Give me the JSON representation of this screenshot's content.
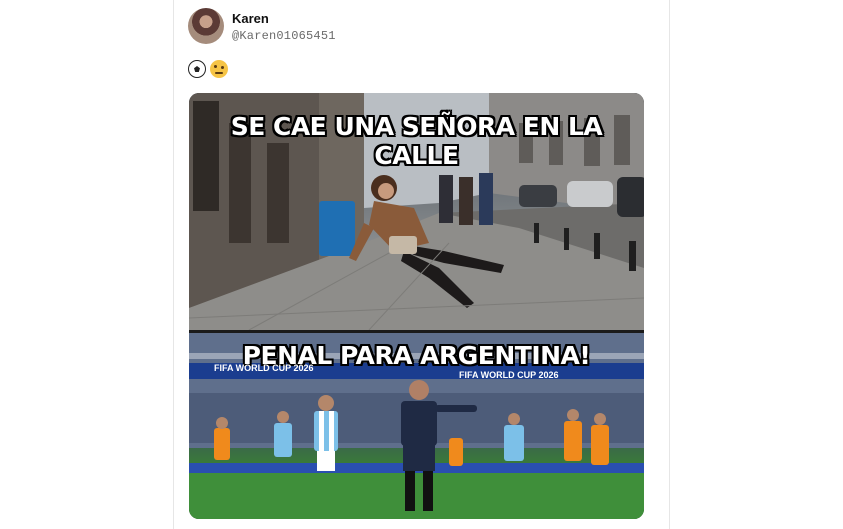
{
  "post": {
    "author_name": "Karen",
    "author_handle": "@Karen01065451",
    "body_emojis": [
      "soccer-ball-icon",
      "face-with-raised-eyebrow-icon"
    ]
  },
  "meme": {
    "top_caption": "SE CAE UNA SEÑORA EN LA CALLE",
    "bottom_caption": "PENAL PARA ARGENTINA!",
    "banner_text": "FIFA WORLD CUP 2026"
  },
  "colors": {
    "card_border": "#e6e6e6",
    "handle_gray": "#6b6b6b",
    "argentina_blue": "#7cc0e8",
    "netherlands_orange": "#f08a1c",
    "referee_navy": "#1f2a44",
    "pitch_green": "#3f8f3a"
  }
}
